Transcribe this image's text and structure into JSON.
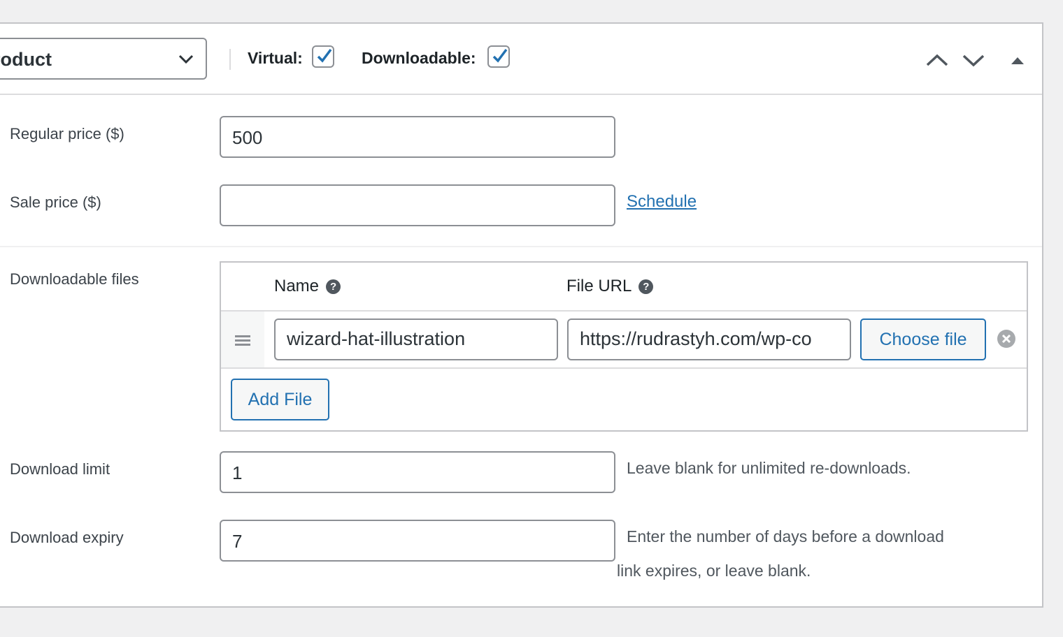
{
  "header": {
    "product_type": "roduct",
    "virtual_label": "Virtual:",
    "virtual_checked": true,
    "downloadable_label": "Downloadable:",
    "downloadable_checked": true,
    "icons": [
      "chevron-up-icon",
      "chevron-down-icon",
      "collapse-triangle-icon"
    ]
  },
  "pricing": {
    "regular_price_label": "Regular price ($)",
    "regular_price_value": "500",
    "sale_price_label": "Sale price ($)",
    "sale_price_value": "",
    "schedule_link": "Schedule"
  },
  "downloadable_files": {
    "label": "Downloadable files",
    "columns": {
      "name": "Name",
      "file_url": "File URL"
    },
    "help_icon": "?",
    "rows": [
      {
        "name": "wizard-hat-illustration",
        "file_url": "https://rudrastyh.com/wp-co",
        "choose_file_label": "Choose file"
      }
    ],
    "add_file_label": "Add File"
  },
  "download_limit": {
    "label": "Download limit",
    "value": "1",
    "help": "Leave blank for unlimited re-downloads."
  },
  "download_expiry": {
    "label": "Download expiry",
    "value": "7",
    "help_line1": "Enter the number of days before a download",
    "help_line2": "link expires, or leave blank."
  },
  "colors": {
    "accent": "#2271b1",
    "border": "#8c8f94",
    "background": "#f0f0f1"
  }
}
